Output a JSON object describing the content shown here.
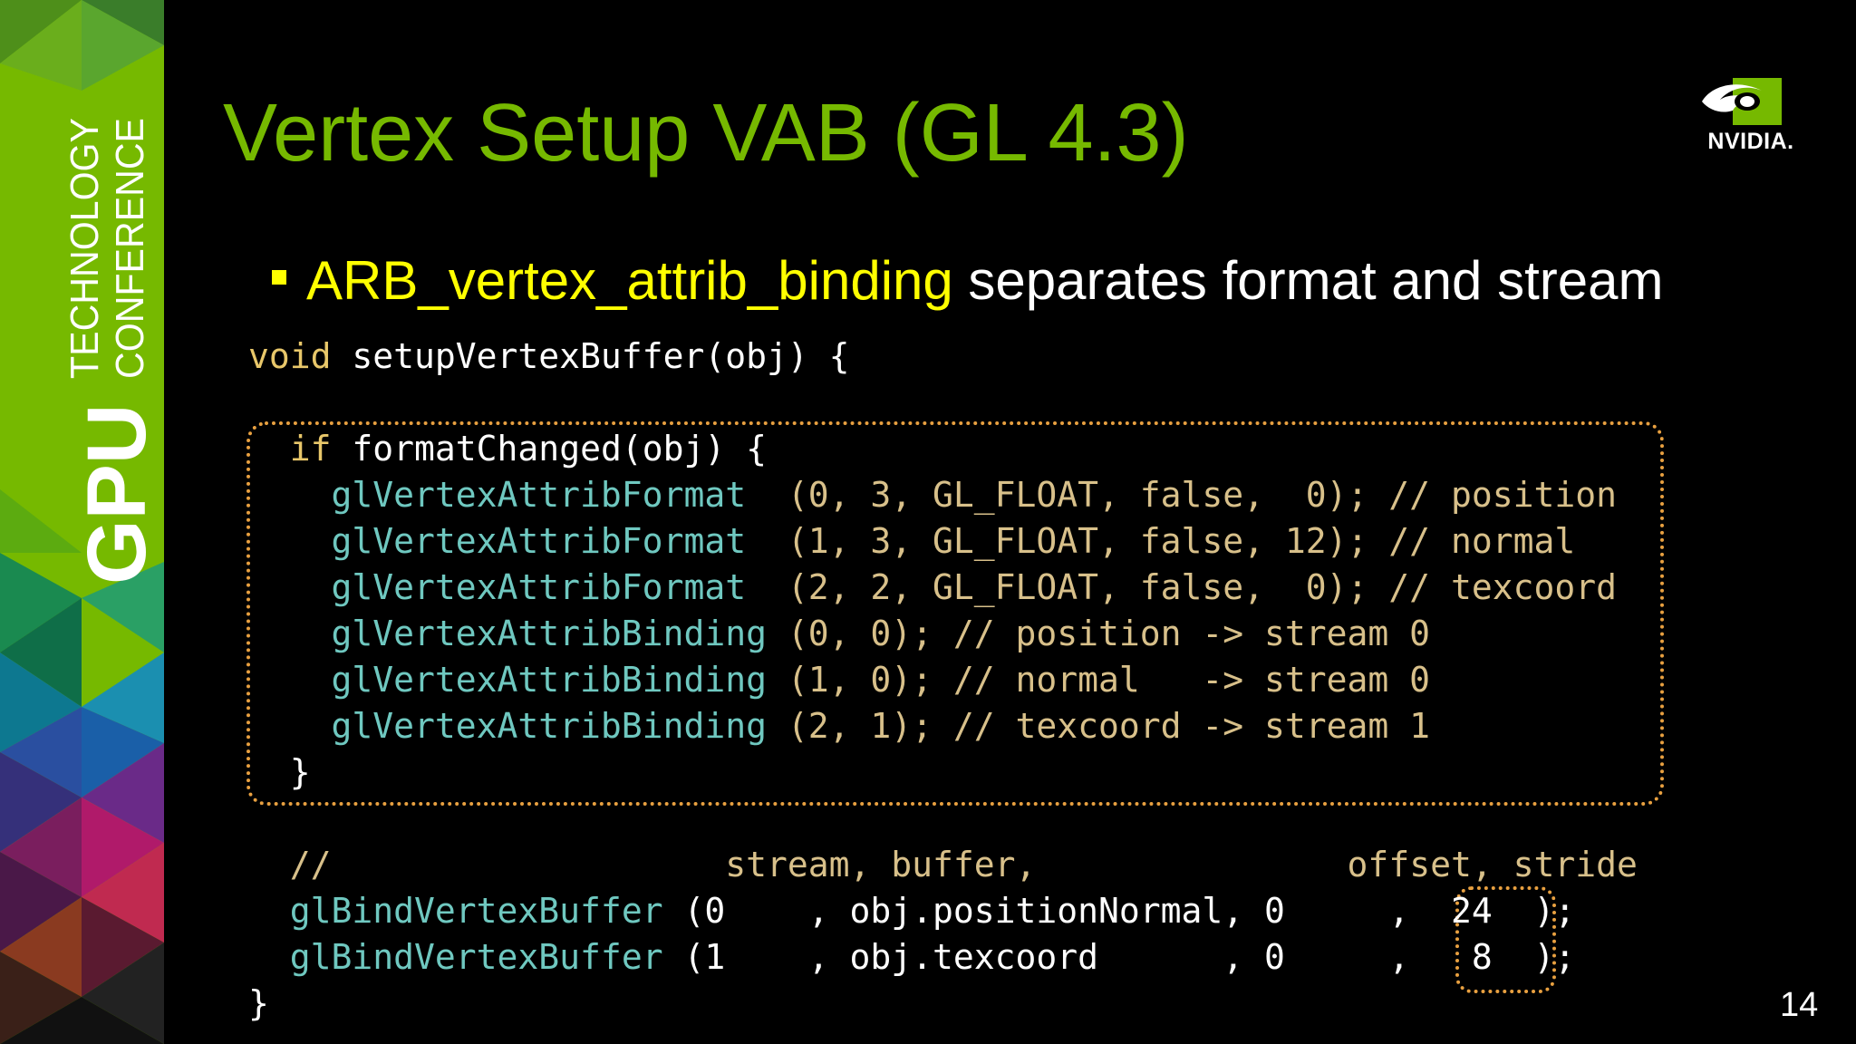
{
  "sidebar": {
    "gpu_label": "GPU",
    "technology_label": "TECHNOLOGY",
    "conference_label": "CONFERENCE"
  },
  "title": "Vertex Setup VAB (GL 4.3)",
  "logo": {
    "text": "NVIDIA."
  },
  "bullet": {
    "keyword": "ARB_vertex_attrib_binding",
    "rest": " separates format and stream"
  },
  "code": {
    "line1_kw": "void",
    "line1_rest": " setupVertexBuffer(obj) {",
    "line2_kw": "if",
    "line2_rest": " formatChanged(obj) {",
    "fmt_fn": "glVertexAttribFormat",
    "fmt1_args": "(0, 3, GL_FLOAT, false,  0); // position",
    "fmt2_args": "(1, 3, GL_FLOAT, false, 12); // normal",
    "fmt3_args": "(2, 2, GL_FLOAT, false,  0); // texcoord",
    "bind_fn": "glVertexAttribBinding",
    "bind1_args": "(0, 0); // position -> stream 0",
    "bind2_args": "(1, 0); // normal   -> stream 0",
    "bind3_args": "(2, 1); // texcoord -> stream 1",
    "close_inner": "}",
    "comment_header_slashes": "//",
    "comment_header_cols": "stream, buffer,               offset, stride",
    "bvb_fn": "glBindVertexBuffer",
    "bvb1_args": "(0    , obj.positionNormal, 0     ,  24  );",
    "bvb2_args": "(1    , obj.texcoord      , 0     ,   8  );",
    "close_outer": "}"
  },
  "page_number": "14",
  "colors": {
    "accent_green": "#76b900",
    "bullet_yellow": "#ffff00",
    "code_teal": "#6fc8c0",
    "code_tan": "#d8c08a",
    "box_orange": "#e8a040"
  }
}
